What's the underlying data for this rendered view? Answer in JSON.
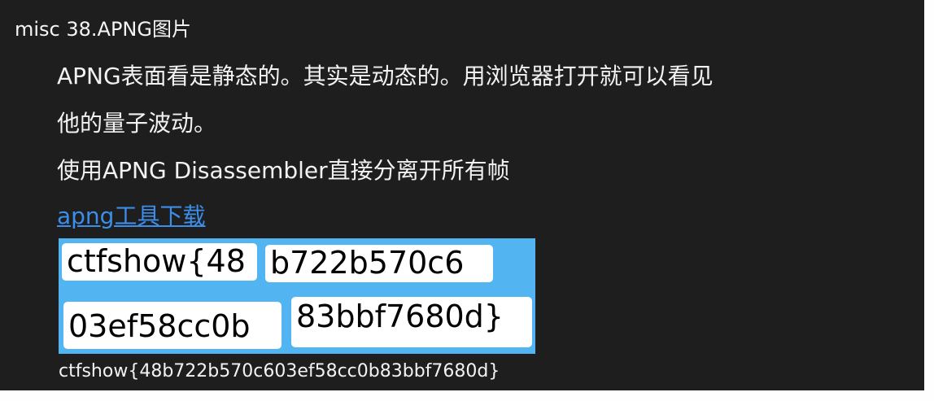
{
  "article": {
    "title": "misc 38.APNG图片",
    "lines": [
      "APNG表面看是静态的。其实是动态的。用浏览器打开就可以看见",
      "他的量子波动。",
      "使用APNG Disassembler直接分离开所有帧"
    ],
    "tool_link": "apng工具下载"
  },
  "frames": [
    "ctfshow{48",
    "b722b570c6",
    "03ef58cc0b",
    "83bbf7680d}"
  ],
  "result": "ctfshow{48b722b570c603ef58cc0b83bbf7680d}",
  "colors": {
    "background": "#1e1e1e",
    "text": "#f2f2f2",
    "link": "#3b8eea",
    "frames_background": "#52b4f0",
    "frame_box": "#ffffff"
  }
}
